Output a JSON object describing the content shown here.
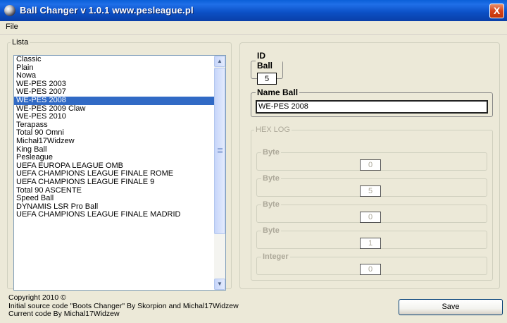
{
  "window": {
    "title": "Ball Changer  v 1.0.1 www.pesleague.pl",
    "close_label": "X"
  },
  "menu": {
    "file": "File"
  },
  "lista": {
    "legend": "Lista",
    "items": [
      "Classic",
      "Plain",
      "Nowa",
      "WE-PES 2003",
      "WE-PES 2007",
      "WE-PES 2008",
      "WE-PES 2009 Claw",
      "WE-PES 2010",
      "Terapass",
      "Total 90 Omni",
      "Michał17Widzew",
      "King Ball",
      "Pesleague",
      "UEFA EUROPA LEAGUE OMB",
      "UEFA CHAMPIONS LEAGUE FINALE ROME",
      "UEFA CHAMPIONS LEAGUE FINALE 9",
      "Total 90 ASCENTE",
      "Speed Ball",
      "DYNAMIS LSR Pro Ball",
      "UEFA CHAMPIONS LEAGUE FINALE MADRID"
    ],
    "selected_index": 5
  },
  "id_ball": {
    "legend": "ID Ball",
    "value": "5"
  },
  "name_ball": {
    "legend": "Name Ball",
    "value": "WE-PES 2008"
  },
  "hex_log": {
    "legend": "HEX LOG",
    "rows": [
      {
        "label": "Byte",
        "value": "0"
      },
      {
        "label": "Byte",
        "value": "5"
      },
      {
        "label": "Byte",
        "value": "0"
      },
      {
        "label": "Byte",
        "value": "1"
      },
      {
        "label": "Integer",
        "value": "0"
      }
    ]
  },
  "footer": {
    "line1": "Copyright 2010 ©",
    "line2": "Initial source code \"Boots Changer\" By Skorpion and Michal17Widzew",
    "line3": "Current code By Michal17Widzew"
  },
  "save_label": "Save"
}
